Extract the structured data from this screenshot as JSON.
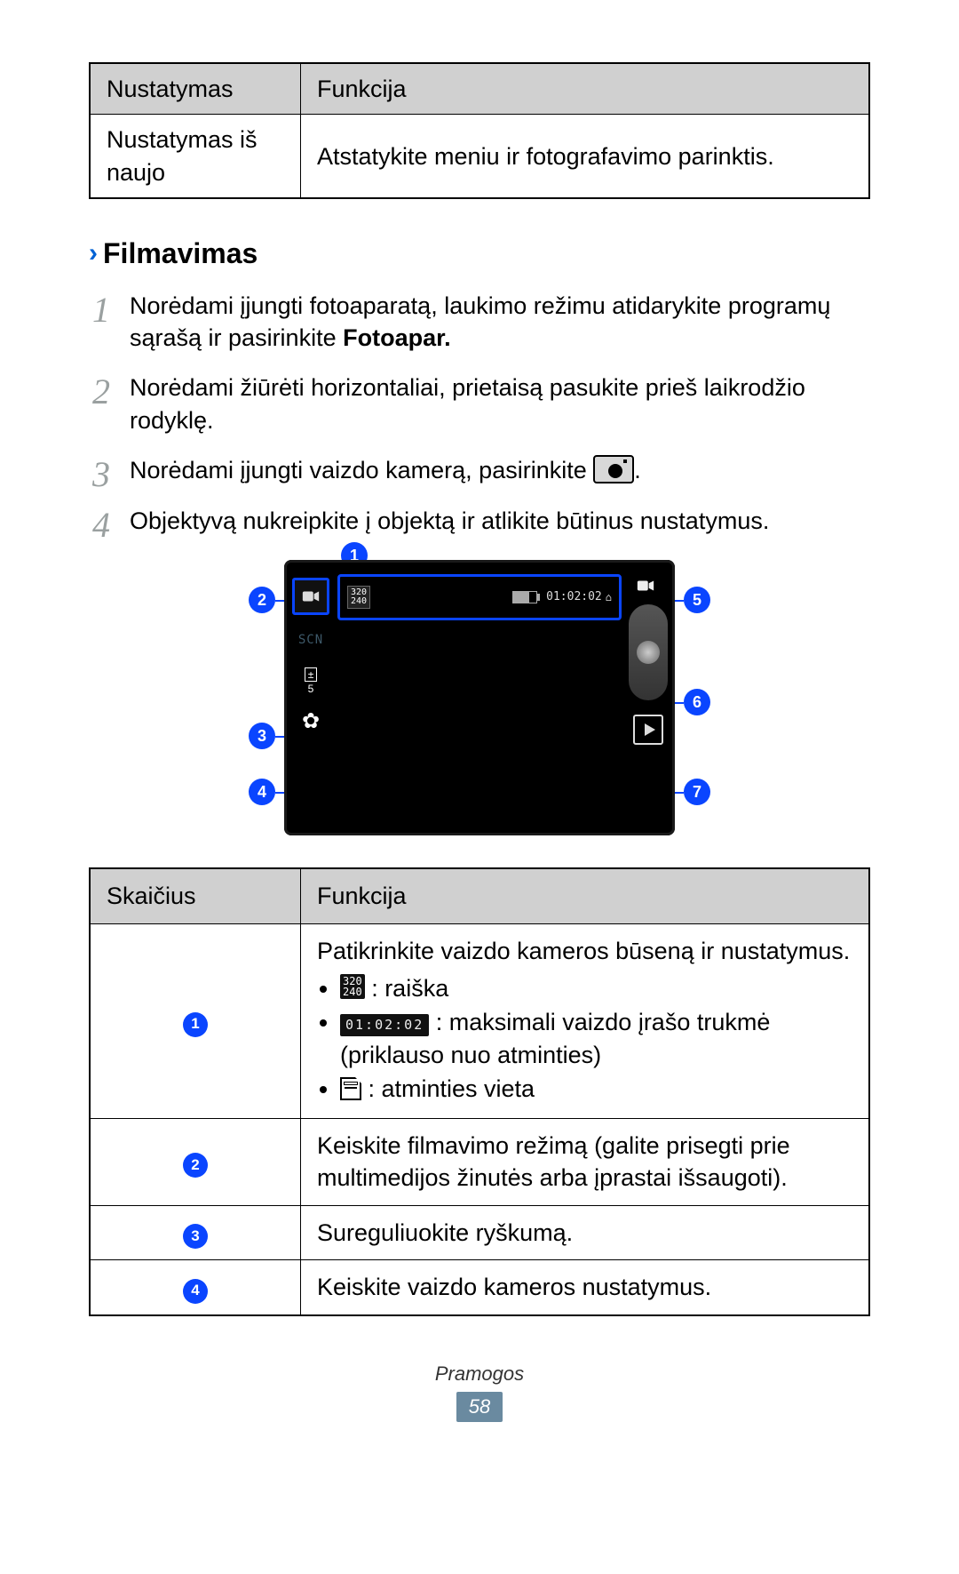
{
  "top_table": {
    "h1": "Nustatymas",
    "h2": "Funkcija",
    "r1c1": "Nustatymas iš naujo",
    "r1c2": "Atstatykite meniu ir fotografavimo parinktis."
  },
  "section_title": "Filmavimas",
  "steps": [
    {
      "pre": "Norėdami įjungti fotoaparatą, laukimo režimu atidarykite programų sąrašą ir pasirinkite ",
      "bold": "Fotoapar."
    },
    {
      "text": "Norėdami žiūrėti horizontaliai, prietaisą pasukite prieš laikrodžio rodyklę."
    },
    {
      "pre": "Norėdami įjungti vaizdo kamerą, pasirinkite ",
      "icon": true,
      "post": "."
    },
    {
      "text": "Objektyvą nukreipkite į objektą ir atlikite būtinus nustatymus."
    }
  ],
  "screen": {
    "resolution": "320\n240",
    "time": "01:02:02",
    "scn": "SCN",
    "ev": "±",
    "ev_val": "5"
  },
  "legend": {
    "h1": "Skaičius",
    "h2": "Funkcija",
    "rows": [
      {
        "n": "1",
        "lead": "Patikrinkite vaizdo kameros būseną ir nustatymus.",
        "bullets": [
          {
            "icon": "res",
            "text": " : raiška"
          },
          {
            "icon": "time",
            "text": " : maksimali vaizdo įrašo trukmė (priklauso nuo atminties)"
          },
          {
            "icon": "sd",
            "text": " : atminties vieta"
          }
        ]
      },
      {
        "n": "2",
        "text": "Keiskite filmavimo režimą (galite prisegti prie multimedijos žinutės arba įprastai išsaugoti)."
      },
      {
        "n": "3",
        "text": "Sureguliuokite ryškumą."
      },
      {
        "n": "4",
        "text": "Keiskite vaizdo kameros nustatymus."
      }
    ]
  },
  "footer": {
    "category": "Pramogos",
    "page": "58"
  }
}
